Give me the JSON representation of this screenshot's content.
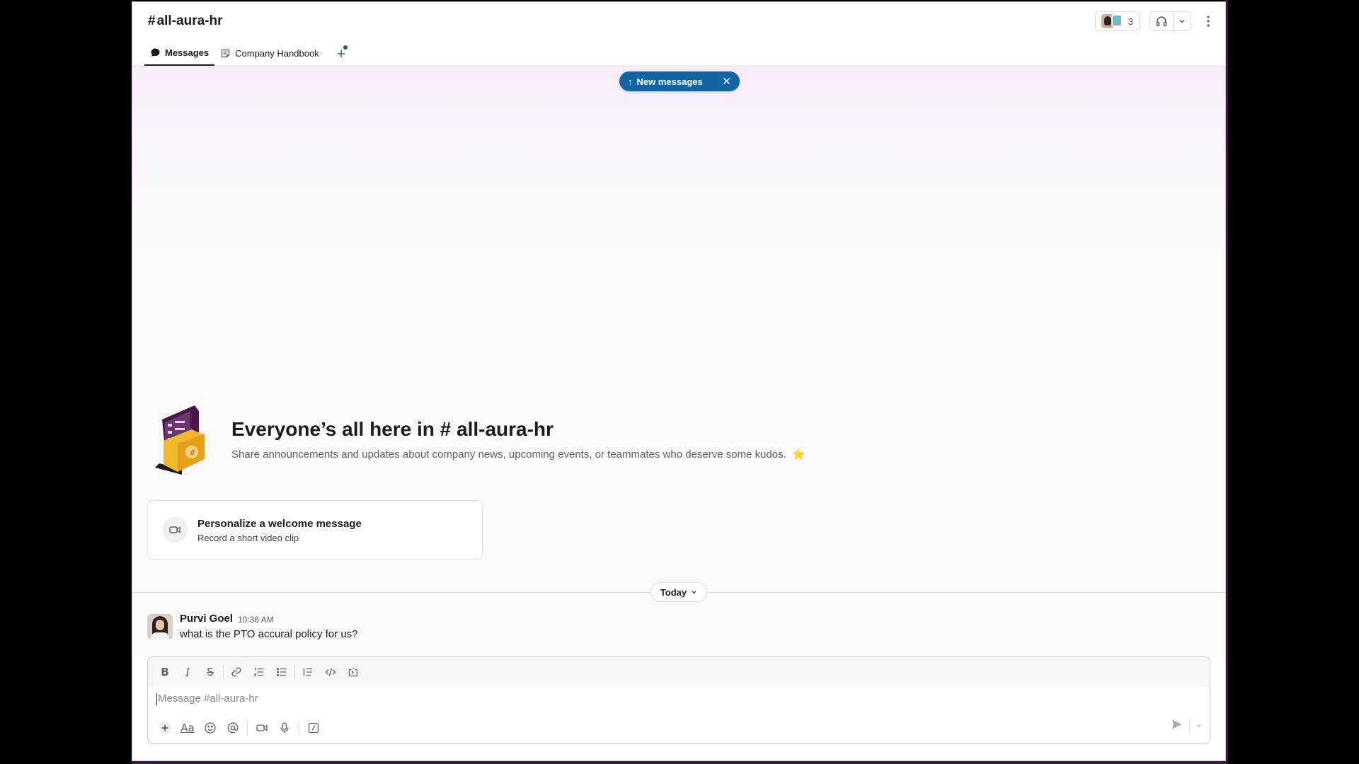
{
  "header": {
    "channel_hash": "#",
    "channel_name": "all-aura-hr",
    "member_count": "3"
  },
  "tabs": [
    {
      "label": "Messages",
      "icon": "chat-bubble-icon",
      "active": true
    },
    {
      "label": "Company Handbook",
      "icon": "canvas-doc-icon",
      "active": false
    }
  ],
  "banner": {
    "new_messages_label": "New messages"
  },
  "intro": {
    "title": "Everyone’s all here in # all-aura-hr",
    "description": "Share announcements and updates about company news, upcoming events, or teammates who deserve some kudos.",
    "emoji": "⭐"
  },
  "welcome_card": {
    "title": "Personalize a welcome message",
    "subtitle": "Record a short video clip"
  },
  "date_divider": {
    "label": "Today"
  },
  "messages": [
    {
      "author": "Purvi Goel",
      "time": "10:36 AM",
      "text": "what is the PTO accural policy for us?"
    }
  ],
  "composer": {
    "placeholder": "Message #all-aura-hr"
  },
  "colors": {
    "accent_blue": "#1264a3",
    "text_primary": "#1d1c1d",
    "text_secondary": "#616061",
    "window_frame": "#3a1a3a"
  }
}
